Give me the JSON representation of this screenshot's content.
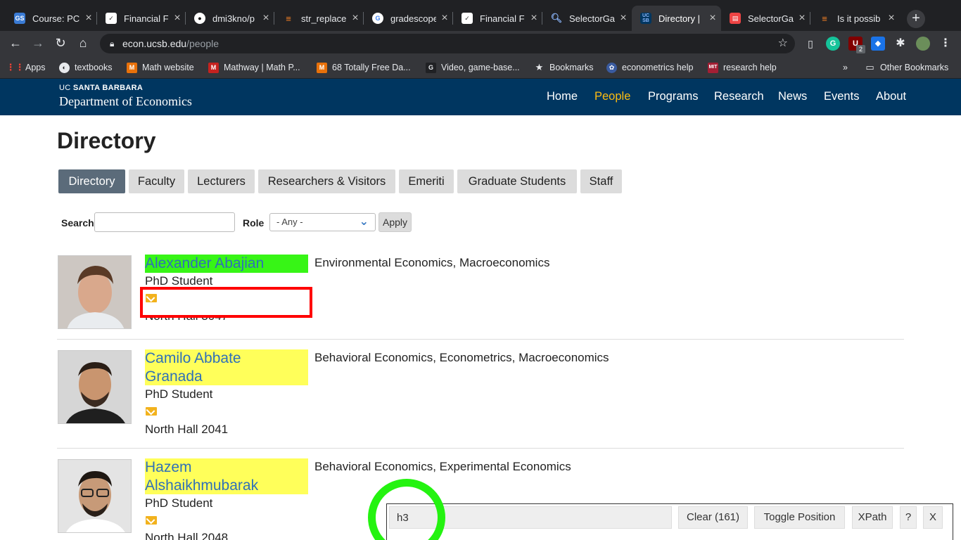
{
  "browser": {
    "tabs": [
      {
        "title": "Course: PC",
        "favicon": "GS",
        "color": "#3a7bd5"
      },
      {
        "title": "Financial F",
        "favicon": "doc",
        "color": "#ffffff"
      },
      {
        "title": "dmi3kno/p",
        "favicon": "github",
        "color": "#ffffff"
      },
      {
        "title": "str_replace",
        "favicon": "stack",
        "color": "#f48024"
      },
      {
        "title": "gradescope",
        "favicon": "G",
        "color": "#4285f4"
      },
      {
        "title": "Financial F",
        "favicon": "doc",
        "color": "#ffffff"
      },
      {
        "title": "SelectorGa",
        "favicon": "search",
        "color": "#4a90e2"
      },
      {
        "title": "Directory |",
        "favicon": "UCSB",
        "color": "#003660"
      },
      {
        "title": "SelectorGa",
        "favicon": "gadget",
        "color": "#e44"
      },
      {
        "title": "Is it possib",
        "favicon": "stack",
        "color": "#f48024"
      }
    ],
    "url_host": "econ.ucsb.edu",
    "url_path": "/people",
    "ext_badge": "2",
    "bookmarks": [
      {
        "label": "Apps",
        "icon": "apps-icon",
        "color": "#ea4335"
      },
      {
        "label": "textbooks",
        "icon": "globe-icon",
        "color": "#5f6368"
      },
      {
        "label": "Math website",
        "icon": "m-icon",
        "color": "#e8710a"
      },
      {
        "label": "Mathway | Math P...",
        "icon": "mathway-icon",
        "color": "#c5221f"
      },
      {
        "label": "68 Totally Free Da...",
        "icon": "m-icon",
        "color": "#e8710a"
      },
      {
        "label": "Video, game-base...",
        "icon": "video-icon",
        "color": "#202124"
      },
      {
        "label": "Bookmarks",
        "icon": "star-icon",
        "color": "#e8eaed"
      },
      {
        "label": "econometrics help",
        "icon": "seal-icon",
        "color": "#3a5ba0"
      },
      {
        "label": "research help",
        "icon": "mit-icon",
        "color": "#a31f34"
      }
    ],
    "more": "»",
    "other_bookmarks": "Other Bookmarks"
  },
  "site": {
    "logo_top_prefix": "UC",
    "logo_top_main": "SANTA BARBARA",
    "logo_bottom": "Department of Economics",
    "nav": [
      {
        "label": "Home"
      },
      {
        "label": "People",
        "active": true
      },
      {
        "label": "Programs"
      },
      {
        "label": "Research"
      },
      {
        "label": "News"
      },
      {
        "label": "Events"
      },
      {
        "label": "About"
      }
    ]
  },
  "page": {
    "title": "Directory",
    "subtabs": [
      "Directory",
      "Faculty",
      "Lecturers",
      "Researchers & Visitors",
      "Emeriti",
      "Graduate Students",
      "Staff"
    ],
    "active_subtab": "Directory",
    "search_label": "Search",
    "search_value": "",
    "role_label": "Role",
    "role_value": "- Any -",
    "apply_label": "Apply"
  },
  "people": [
    {
      "name": "Alexander Abajian",
      "name_line2": "",
      "role": "PhD Student",
      "office": "North Hall 3047",
      "interests": "Environmental Economics, Macroeconomics",
      "highlight": "#37f516"
    },
    {
      "name": "Camilo Abbate",
      "name_line2": "Granada",
      "role": "PhD Student",
      "office": "North Hall 2041",
      "interests": "Behavioral Economics, Econometrics, Macroeconomics",
      "highlight": "#ffff5a"
    },
    {
      "name": "Hazem",
      "name_line2": "Alshaikhmubarak",
      "role": "PhD Student",
      "office": "North Hall 2048",
      "interests": "Behavioral Economics, Experimental Economics",
      "highlight": "#ffff5a"
    }
  ],
  "selector_gadget": {
    "selector": "h3",
    "clear_label": "Clear (161)",
    "toggle_label": "Toggle Position",
    "xpath_label": "XPath",
    "help_label": "?",
    "close_label": "X"
  }
}
